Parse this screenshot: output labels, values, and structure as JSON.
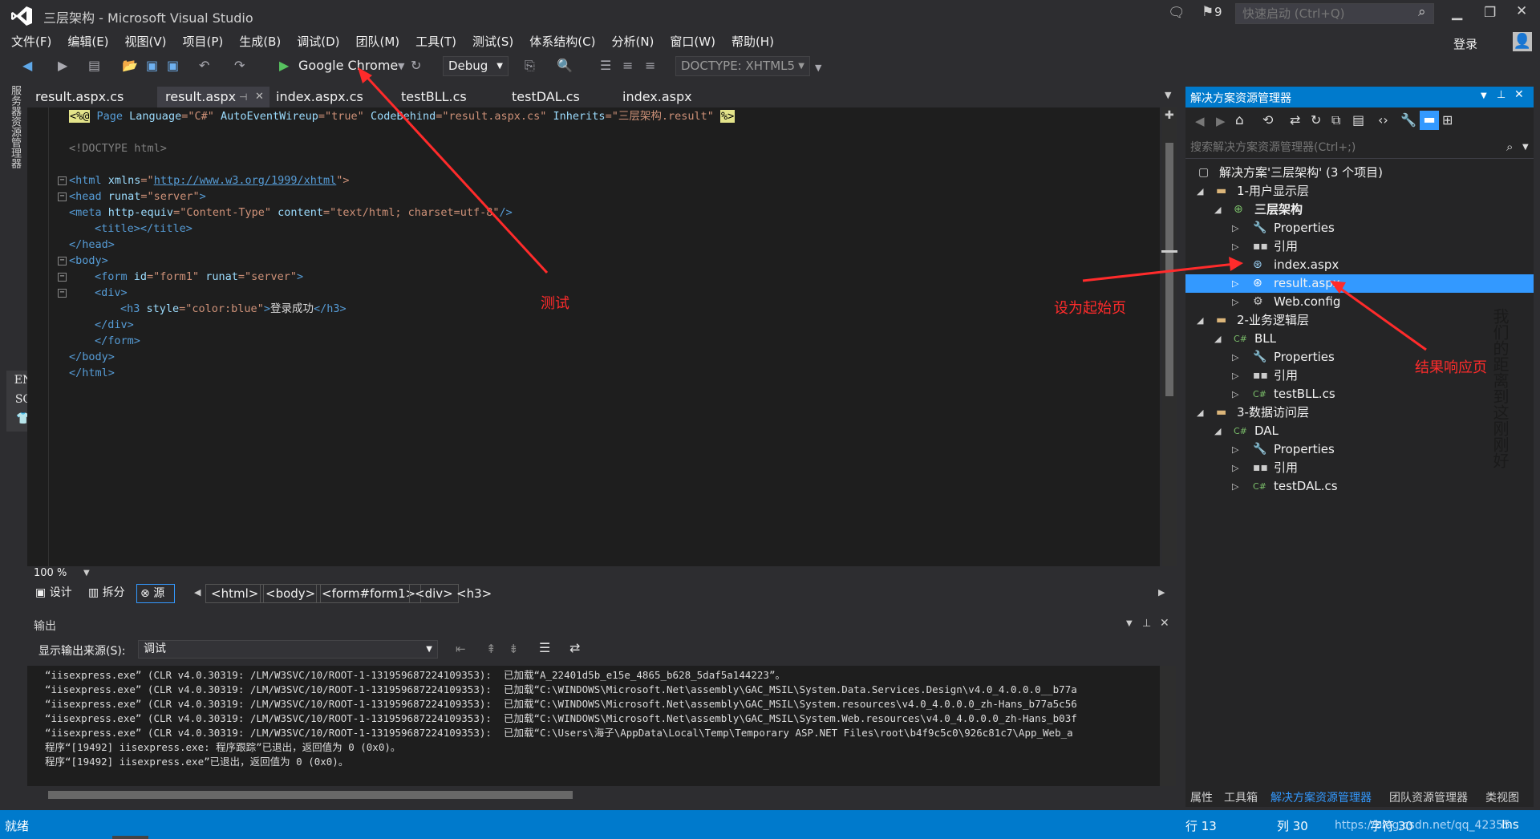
{
  "window": {
    "title": "三层架构 - Microsoft Visual Studio",
    "notification_count": "9",
    "quick_launch_placeholder": "快速启动 (Ctrl+Q)",
    "login_label": "登录"
  },
  "menu": [
    "文件(F)",
    "编辑(E)",
    "视图(V)",
    "项目(P)",
    "生成(B)",
    "调试(D)",
    "团队(M)",
    "工具(T)",
    "测试(S)",
    "体系结构(C)",
    "分析(N)",
    "窗口(W)",
    "帮助(H)"
  ],
  "toolbar": {
    "run_target": "Google Chrome",
    "config": "Debug",
    "doctype": "DOCTYPE: XHTML5"
  },
  "left_strip": {
    "server_explorer": "服务器资源管理器",
    "ime_line1": "EN",
    "ime_line2": "SC"
  },
  "doc_tabs": [
    "result.aspx.cs",
    "result.aspx",
    "index.aspx.cs",
    "testBLL.cs",
    "testDAL.cs",
    "index.aspx"
  ],
  "code": {
    "l1_open": "<%@",
    "l1_page": " Page ",
    "l1_a1": "Language",
    "l1_v1": "=\"C#\" ",
    "l1_a2": "AutoEventWireup",
    "l1_v2": "=\"true\" ",
    "l1_a3": "CodeBehind",
    "l1_v3": "=\"result.aspx.cs\" ",
    "l1_a4": "Inherits",
    "l1_v4": "=\"三层架构.result\" ",
    "l1_close": "%>",
    "l2": "<!DOCTYPE html>",
    "l3_tag": "<html ",
    "l3_attr": "xmlns",
    "l3_eq": "=\"",
    "l3_link": "http://www.w3.org/1999/xhtml",
    "l3_end": "\">",
    "l4_tag": "<head ",
    "l4_attr": "runat",
    "l4_val": "=\"server\"",
    "l4_end": ">",
    "l5_tag": "<meta ",
    "l5_a1": "http-equiv",
    "l5_v1": "=\"Content-Type\" ",
    "l5_a2": "content",
    "l5_v2": "=\"text/html; charset=utf-8\"",
    "l5_end": "/>",
    "l6": "<title></title>",
    "l7": "</head>",
    "l8": "<body>",
    "l9_tag": "<form ",
    "l9_a1": "id",
    "l9_v1": "=\"form1\" ",
    "l9_a2": "runat",
    "l9_v2": "=\"server\"",
    "l9_end": ">",
    "l10": "<div>",
    "l11_tag": "<h3 ",
    "l11_attr": "style",
    "l11_val": "=\"color:blue\"",
    "l11_gt": ">",
    "l11_text": "登录成功",
    "l11_end": "</h3>",
    "l12": "</div>",
    "l13": "</form>",
    "l14": "</body>",
    "l15": "</html>"
  },
  "editor_zoom": "100 %",
  "views": {
    "design": "设计",
    "split": "拆分",
    "source": "源"
  },
  "breadcrumbs": [
    "<html>",
    "<body>",
    "<form#form1>",
    "<div>",
    "<h3>"
  ],
  "output": {
    "title": "输出",
    "source_label": "显示输出来源(S):",
    "source_value": "调试",
    "lines": [
      "“iisexpress.exe” (CLR v4.0.30319: /LM/W3SVC/10/ROOT-1-131959687224109353):  已加载“A_22401d5b_e15e_4865_b628_5daf5a144223”。",
      "“iisexpress.exe” (CLR v4.0.30319: /LM/W3SVC/10/ROOT-1-131959687224109353):  已加载“C:\\WINDOWS\\Microsoft.Net\\assembly\\GAC_MSIL\\System.Data.Services.Design\\v4.0_4.0.0.0__b77a",
      "“iisexpress.exe” (CLR v4.0.30319: /LM/W3SVC/10/ROOT-1-131959687224109353):  已加载“C:\\WINDOWS\\Microsoft.Net\\assembly\\GAC_MSIL\\System.resources\\v4.0_4.0.0.0_zh-Hans_b77a5c56",
      "“iisexpress.exe” (CLR v4.0.30319: /LM/W3SVC/10/ROOT-1-131959687224109353):  已加载“C:\\WINDOWS\\Microsoft.Net\\assembly\\GAC_MSIL\\System.Web.resources\\v4.0_4.0.0.0_zh-Hans_b03f",
      "“iisexpress.exe” (CLR v4.0.30319: /LM/W3SVC/10/ROOT-1-131959687224109353):  已加载“C:\\Users\\海子\\AppData\\Local\\Temp\\Temporary ASP.NET Files\\root\\b4f9c5c0\\926c81c7\\App_Web_a",
      "程序“[19492] iisexpress.exe: 程序跟踪”已退出，返回值为 0 (0x0)。",
      "程序“[19492] iisexpress.exe”已退出，返回值为 0 (0x0)。"
    ]
  },
  "solution": {
    "title": "解决方案资源管理器",
    "search_placeholder": "搜索解决方案资源管理器(Ctrl+;)",
    "root": "解决方案'三层架构' (3 个项目)",
    "n1": "1-用户显示层",
    "n1_proj": "三层架构",
    "n1_props": "Properties",
    "n1_refs": "引用",
    "n1_index": "index.aspx",
    "n1_result": "result.aspx",
    "n1_webconfig": "Web.config",
    "n2": "2-业务逻辑层",
    "n2_proj": "BLL",
    "n2_props": "Properties",
    "n2_refs": "引用",
    "n2_file": "testBLL.cs",
    "n3": "3-数据访问层",
    "n3_proj": "DAL",
    "n3_props": "Properties",
    "n3_refs": "引用",
    "n3_file": "testDAL.cs",
    "bottom_tabs": [
      "属性",
      "工具箱",
      "解决方案资源管理器",
      "团队资源管理器",
      "类视图"
    ]
  },
  "status": {
    "ready": "就绪",
    "row": "行 13",
    "col": "列 30",
    "ch": "字符 30",
    "ins": "Ins",
    "url": "https://blog.csdn.net/qq_42355"
  },
  "annotations": {
    "test": "测试",
    "start_page": "设为起始页",
    "result_page": "结果响应页",
    "vertical": "我们的距离到这刚刚好"
  },
  "colors": {
    "accent": "#007acc",
    "selection": "#3399ff",
    "annotation": "#ff2b2b"
  }
}
